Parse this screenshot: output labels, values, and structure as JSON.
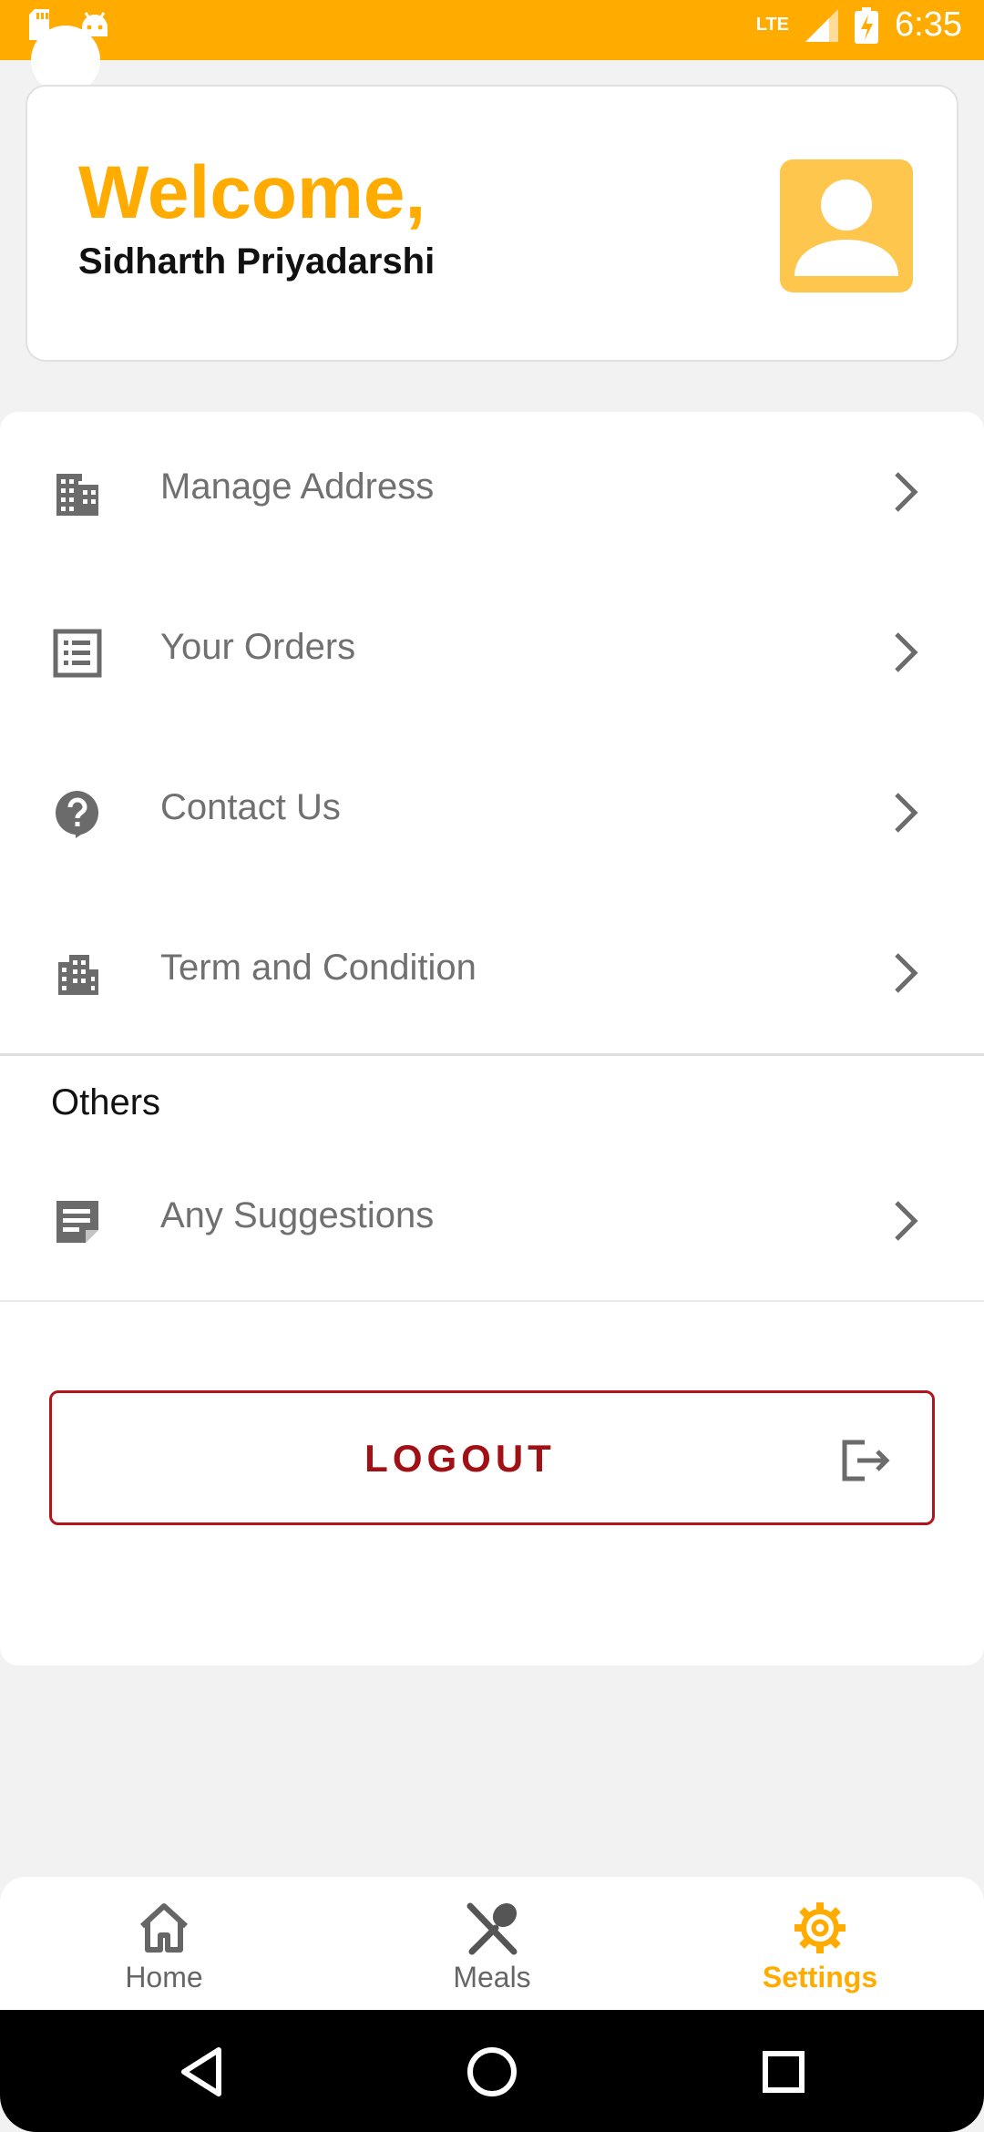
{
  "status_bar": {
    "time": "6:35",
    "network": "LTE",
    "icons": [
      "sd-card-icon",
      "android-icon",
      "signal-icon",
      "battery-charging-icon"
    ]
  },
  "welcome": {
    "title": "Welcome,",
    "name": "Sidharth Priyadarshi",
    "avatar_icon": "person-icon"
  },
  "menu": {
    "items": [
      {
        "label": "Manage Address",
        "icon": "building-icon"
      },
      {
        "label": "Your Orders",
        "icon": "list-icon"
      },
      {
        "label": "Contact Us",
        "icon": "help-icon"
      },
      {
        "label": "Term and Condition",
        "icon": "business-icon"
      }
    ],
    "others_title": "Others",
    "others_items": [
      {
        "label": "Any Suggestions",
        "icon": "note-icon"
      }
    ]
  },
  "logout": {
    "label": "LOGOUT",
    "icon": "exit-icon"
  },
  "bottom_nav": {
    "items": [
      {
        "label": "Home",
        "icon": "home-icon",
        "active": false
      },
      {
        "label": "Meals",
        "icon": "utensils-icon",
        "active": false
      },
      {
        "label": "Settings",
        "icon": "gear-icon",
        "active": true
      }
    ]
  },
  "colors": {
    "accent": "#ffab00",
    "logout": "#a01014",
    "text_muted": "#707070"
  }
}
